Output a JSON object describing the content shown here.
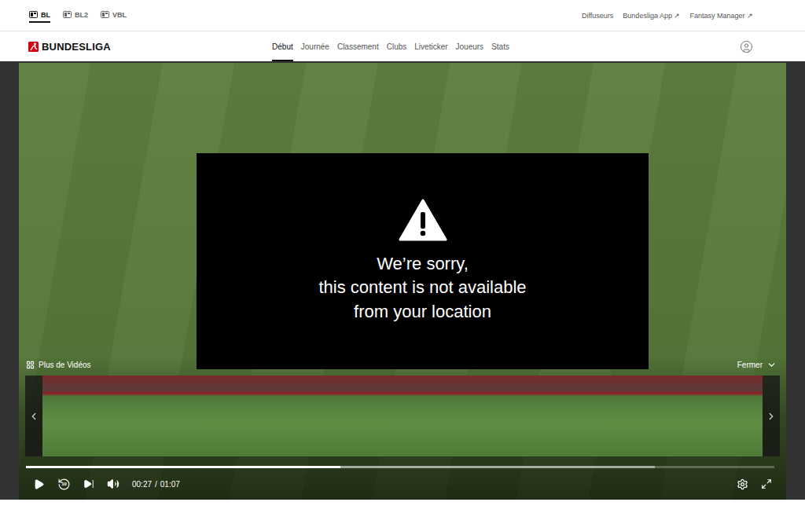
{
  "league_tabs": [
    {
      "label": "BL",
      "selected": true
    },
    {
      "label": "BL2",
      "selected": false
    },
    {
      "label": "VBL",
      "selected": false
    }
  ],
  "top_links": [
    {
      "label": "Diffuseurs",
      "arrow": ""
    },
    {
      "label": "Bundesliga App",
      "arrow": "↗"
    },
    {
      "label": "Fantasy Manager",
      "arrow": "↗"
    }
  ],
  "logo": {
    "text": "BUNDESLIGA"
  },
  "nav": [
    {
      "label": "Début",
      "selected": true
    },
    {
      "label": "Journée",
      "selected": false
    },
    {
      "label": "Classement",
      "selected": false
    },
    {
      "label": "Clubs",
      "selected": false
    },
    {
      "label": "Liveticker",
      "selected": false
    },
    {
      "label": "Joueurs",
      "selected": false
    },
    {
      "label": "Stats",
      "selected": false
    }
  ],
  "player": {
    "error_lines": [
      "We’re sorry,",
      "this content is not available",
      "from your location"
    ],
    "more_videos": "Plus de Vidéos",
    "close": "Fermer",
    "thumbnails": [
      {
        "selected": false
      },
      {
        "selected": false
      },
      {
        "selected": false
      },
      {
        "selected": false
      },
      {
        "selected": false
      }
    ],
    "progress": {
      "level": 0.42,
      "buffered": 0.84
    },
    "replay_seconds": "10",
    "playing": false,
    "muted": false,
    "time": {
      "current": "00:27",
      "separator": "/",
      "duration": "01:07"
    }
  }
}
